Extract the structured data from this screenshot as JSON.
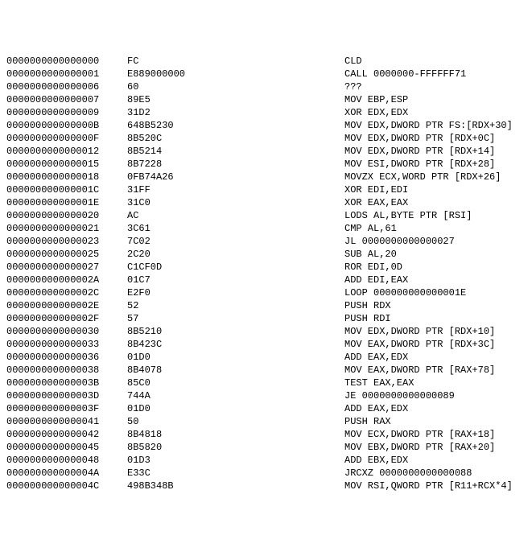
{
  "rows": [
    {
      "addr": "0000000000000000",
      "bytes": "FC",
      "mnemonic": "CLD"
    },
    {
      "addr": "0000000000000001",
      "bytes": "E889000000",
      "mnemonic": "CALL 0000000-FFFFFF71"
    },
    {
      "addr": "0000000000000006",
      "bytes": "60",
      "mnemonic": "???"
    },
    {
      "addr": "0000000000000007",
      "bytes": "89E5",
      "mnemonic": "MOV EBP,ESP"
    },
    {
      "addr": "0000000000000009",
      "bytes": "31D2",
      "mnemonic": "XOR EDX,EDX"
    },
    {
      "addr": "000000000000000B",
      "bytes": "648B5230",
      "mnemonic": "MOV EDX,DWORD PTR FS:[RDX+30]"
    },
    {
      "addr": "000000000000000F",
      "bytes": "8B520C",
      "mnemonic": "MOV EDX,DWORD PTR [RDX+0C]"
    },
    {
      "addr": "0000000000000012",
      "bytes": "8B5214",
      "mnemonic": "MOV EDX,DWORD PTR [RDX+14]"
    },
    {
      "addr": "0000000000000015",
      "bytes": "8B7228",
      "mnemonic": "MOV ESI,DWORD PTR [RDX+28]"
    },
    {
      "addr": "0000000000000018",
      "bytes": "0FB74A26",
      "mnemonic": "MOVZX ECX,WORD PTR [RDX+26]"
    },
    {
      "addr": "000000000000001C",
      "bytes": "31FF",
      "mnemonic": "XOR EDI,EDI"
    },
    {
      "addr": "000000000000001E",
      "bytes": "31C0",
      "mnemonic": "XOR EAX,EAX"
    },
    {
      "addr": "0000000000000020",
      "bytes": "AC",
      "mnemonic": "LODS AL,BYTE PTR [RSI]"
    },
    {
      "addr": "0000000000000021",
      "bytes": "3C61",
      "mnemonic": "CMP AL,61"
    },
    {
      "addr": "0000000000000023",
      "bytes": "7C02",
      "mnemonic": "JL 0000000000000027"
    },
    {
      "addr": "0000000000000025",
      "bytes": "2C20",
      "mnemonic": "SUB AL,20"
    },
    {
      "addr": "0000000000000027",
      "bytes": "C1CF0D",
      "mnemonic": "ROR EDI,0D"
    },
    {
      "addr": "000000000000002A",
      "bytes": "01C7",
      "mnemonic": "ADD EDI,EAX"
    },
    {
      "addr": "000000000000002C",
      "bytes": "E2F0",
      "mnemonic": "LOOP 000000000000001E"
    },
    {
      "addr": "000000000000002E",
      "bytes": "52",
      "mnemonic": "PUSH RDX"
    },
    {
      "addr": "000000000000002F",
      "bytes": "57",
      "mnemonic": "PUSH RDI"
    },
    {
      "addr": "0000000000000030",
      "bytes": "8B5210",
      "mnemonic": "MOV EDX,DWORD PTR [RDX+10]"
    },
    {
      "addr": "0000000000000033",
      "bytes": "8B423C",
      "mnemonic": "MOV EAX,DWORD PTR [RDX+3C]"
    },
    {
      "addr": "0000000000000036",
      "bytes": "01D0",
      "mnemonic": "ADD EAX,EDX"
    },
    {
      "addr": "0000000000000038",
      "bytes": "8B4078",
      "mnemonic": "MOV EAX,DWORD PTR [RAX+78]"
    },
    {
      "addr": "000000000000003B",
      "bytes": "85C0",
      "mnemonic": "TEST EAX,EAX"
    },
    {
      "addr": "000000000000003D",
      "bytes": "744A",
      "mnemonic": "JE 0000000000000089"
    },
    {
      "addr": "000000000000003F",
      "bytes": "01D0",
      "mnemonic": "ADD EAX,EDX"
    },
    {
      "addr": "0000000000000041",
      "bytes": "50",
      "mnemonic": "PUSH RAX"
    },
    {
      "addr": "0000000000000042",
      "bytes": "8B4818",
      "mnemonic": "MOV ECX,DWORD PTR [RAX+18]"
    },
    {
      "addr": "0000000000000045",
      "bytes": "8B5820",
      "mnemonic": "MOV EBX,DWORD PTR [RAX+20]"
    },
    {
      "addr": "0000000000000048",
      "bytes": "01D3",
      "mnemonic": "ADD EBX,EDX"
    },
    {
      "addr": "000000000000004A",
      "bytes": "E33C",
      "mnemonic": "JRCXZ 0000000000000088"
    },
    {
      "addr": "000000000000004C",
      "bytes": "498B348B",
      "mnemonic": "MOV RSI,QWORD PTR [R11+RCX*4]"
    }
  ]
}
